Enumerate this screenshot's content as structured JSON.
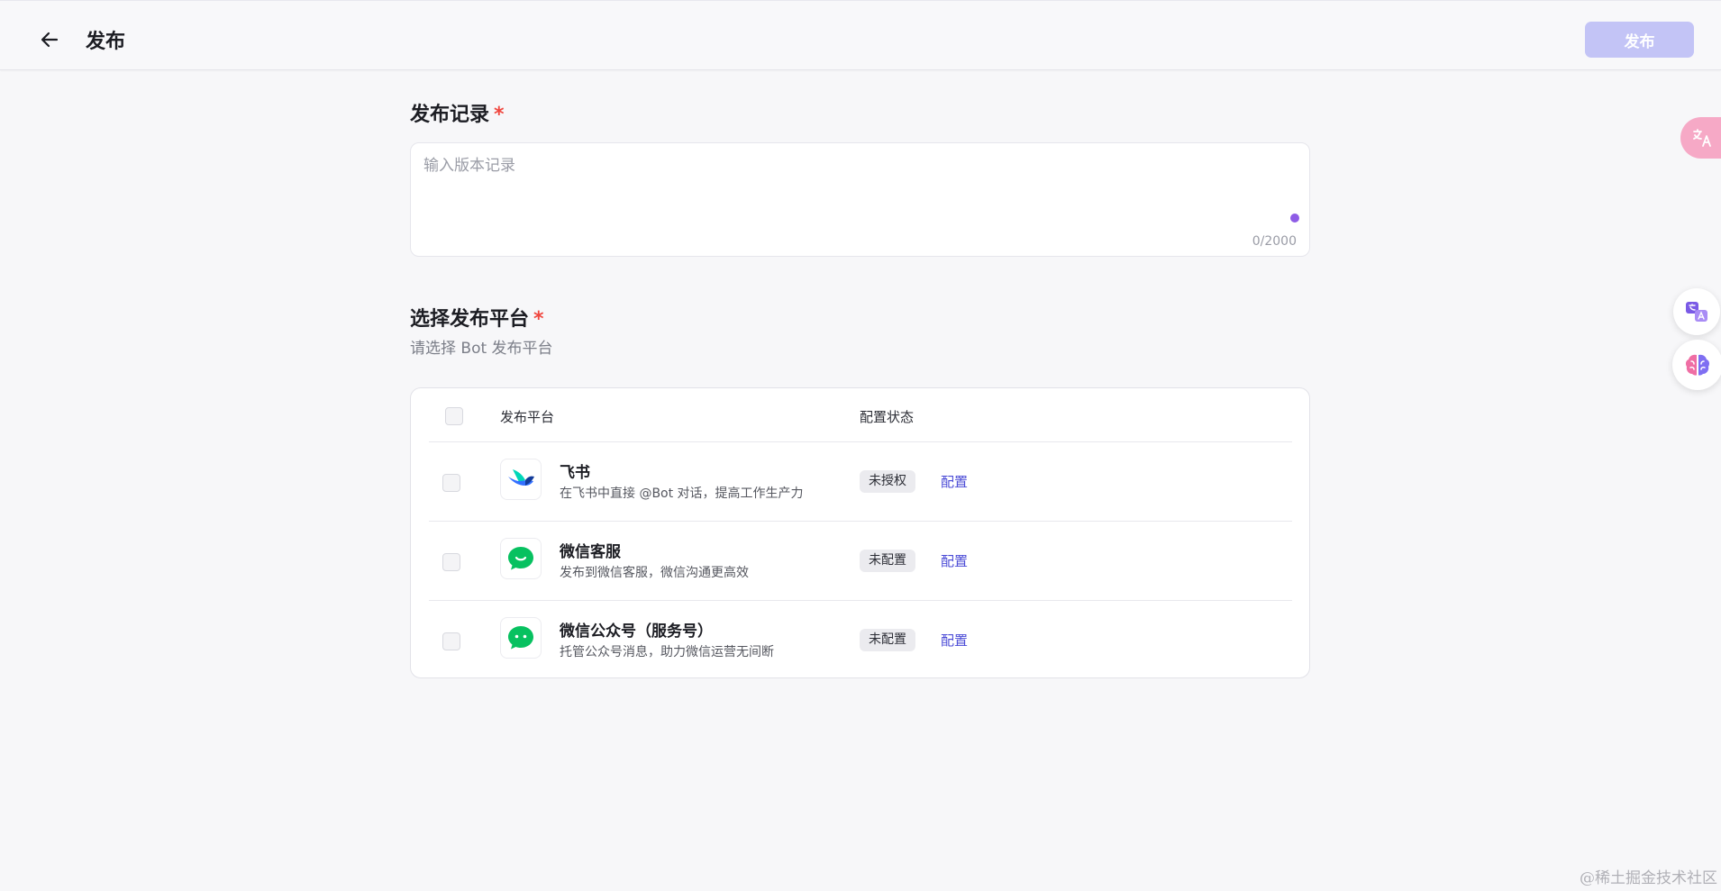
{
  "header": {
    "title": "发布",
    "publish_label": "发布",
    "back_icon": "arrow-left-icon"
  },
  "record_section": {
    "title": "发布记录",
    "required_mark": "*",
    "placeholder": "输入版本记录",
    "value": "",
    "counter": "0/2000"
  },
  "platform_section": {
    "title": "选择发布平台",
    "required_mark": "*",
    "subtitle": "请选择 Bot 发布平台",
    "columns": [
      "发布平台",
      "配置状态"
    ],
    "rows": [
      {
        "name": "飞书",
        "desc": "在飞书中直接 @Bot 对话，提高工作生产力",
        "status": "未授权",
        "action": "配置",
        "icon": "feishu-logo-icon"
      },
      {
        "name": "微信客服",
        "desc": "发布到微信客服，微信沟通更高效",
        "status": "未配置",
        "action": "配置",
        "icon": "wechat-service-icon"
      },
      {
        "name": "微信公众号（服务号）",
        "desc": "托管公众号消息，助力微信运营无间断",
        "status": "未配置",
        "action": "配置",
        "icon": "wechat-official-icon"
      }
    ]
  },
  "floating": {
    "translate_icon": "translate-icon",
    "translate2_icon": "translate-circle-icon",
    "brain_icon": "brain-icon"
  },
  "watermark": "@稀土掘金技术社区",
  "colors": {
    "accent": "#4b4bd6",
    "publish_disabled": "#c3c4f6",
    "required": "#f0473f",
    "wechat_green": "#07c160"
  }
}
